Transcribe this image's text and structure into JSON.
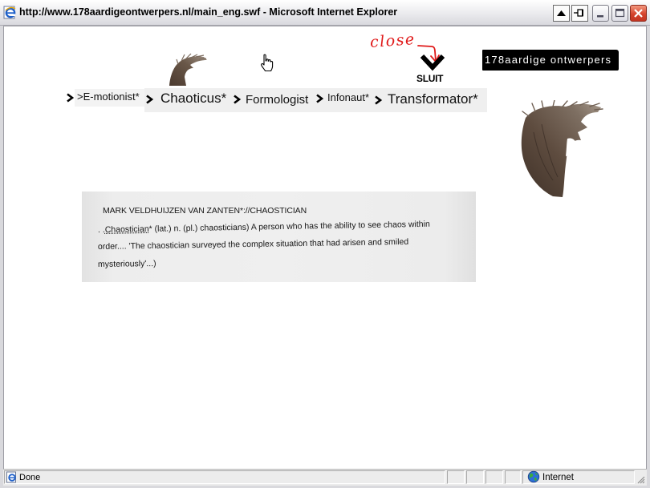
{
  "window": {
    "title": "http://www.178aardigeontwerpers.nl/main_eng.swf - Microsoft Internet Explorer",
    "icons": [
      "ie-page-icon",
      "roll-up-icon",
      "pin-icon",
      "minimize-icon",
      "maximize-icon",
      "close-icon"
    ]
  },
  "page": {
    "annotation": "close",
    "close_label": "SLUIT",
    "logo": "178aardige ontwerpers",
    "nav": [
      {
        "label": ">E-motionist*"
      },
      {
        "label": "Chaoticus*"
      },
      {
        "label": "Formologist"
      },
      {
        "label": "Infonaut*"
      },
      {
        "label": "Transformator*"
      }
    ],
    "profile": {
      "heading": "MARK VELDHUIJZEN VAN ZANTEN*://CHAOSTICIAN",
      "definition_prefix": ". .",
      "definition_term": "Chaostician",
      "definition_rest": "* (lat.) n. (pl.) chaosticians) A person who has the ability to see chaos within",
      "line2": "order.... 'The chaostician surveyed the complex situation that had arisen and smiled",
      "line3": "mysteriously'...)"
    }
  },
  "status_bar": {
    "text": "Done",
    "zone": "Internet",
    "icons": [
      "page-done-icon",
      "globe-icon"
    ]
  },
  "colors": {
    "annotation_red": "#e01a1a",
    "logo_bg": "#000000",
    "scan_bg": "#ececec",
    "close_button": "#d5432c"
  }
}
